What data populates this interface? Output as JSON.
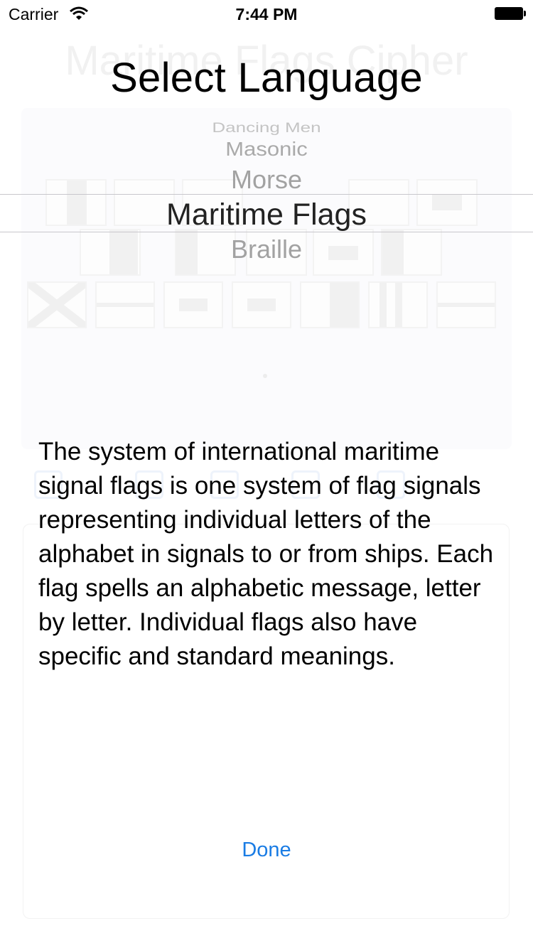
{
  "status_bar": {
    "carrier": "Carrier",
    "time": "7:44 PM"
  },
  "background": {
    "title": "Maritime Flags Cipher"
  },
  "sheet": {
    "title": "Select Language",
    "picker_options": [
      "Dancing Men",
      "Masonic",
      "Morse",
      "Maritime Flags",
      "Braille"
    ],
    "selected_option": "Maritime Flags",
    "description": "The system of international maritime signal flags is one system of flag signals representing individual letters of the alphabet in signals to or from ships. Each flag spells an alphabetic message, letter by letter. Individual flags also have specific and standard meanings.",
    "done_label": "Done"
  },
  "colors": {
    "accent": "#1a7ce4",
    "separator": "#c8c7cc"
  }
}
